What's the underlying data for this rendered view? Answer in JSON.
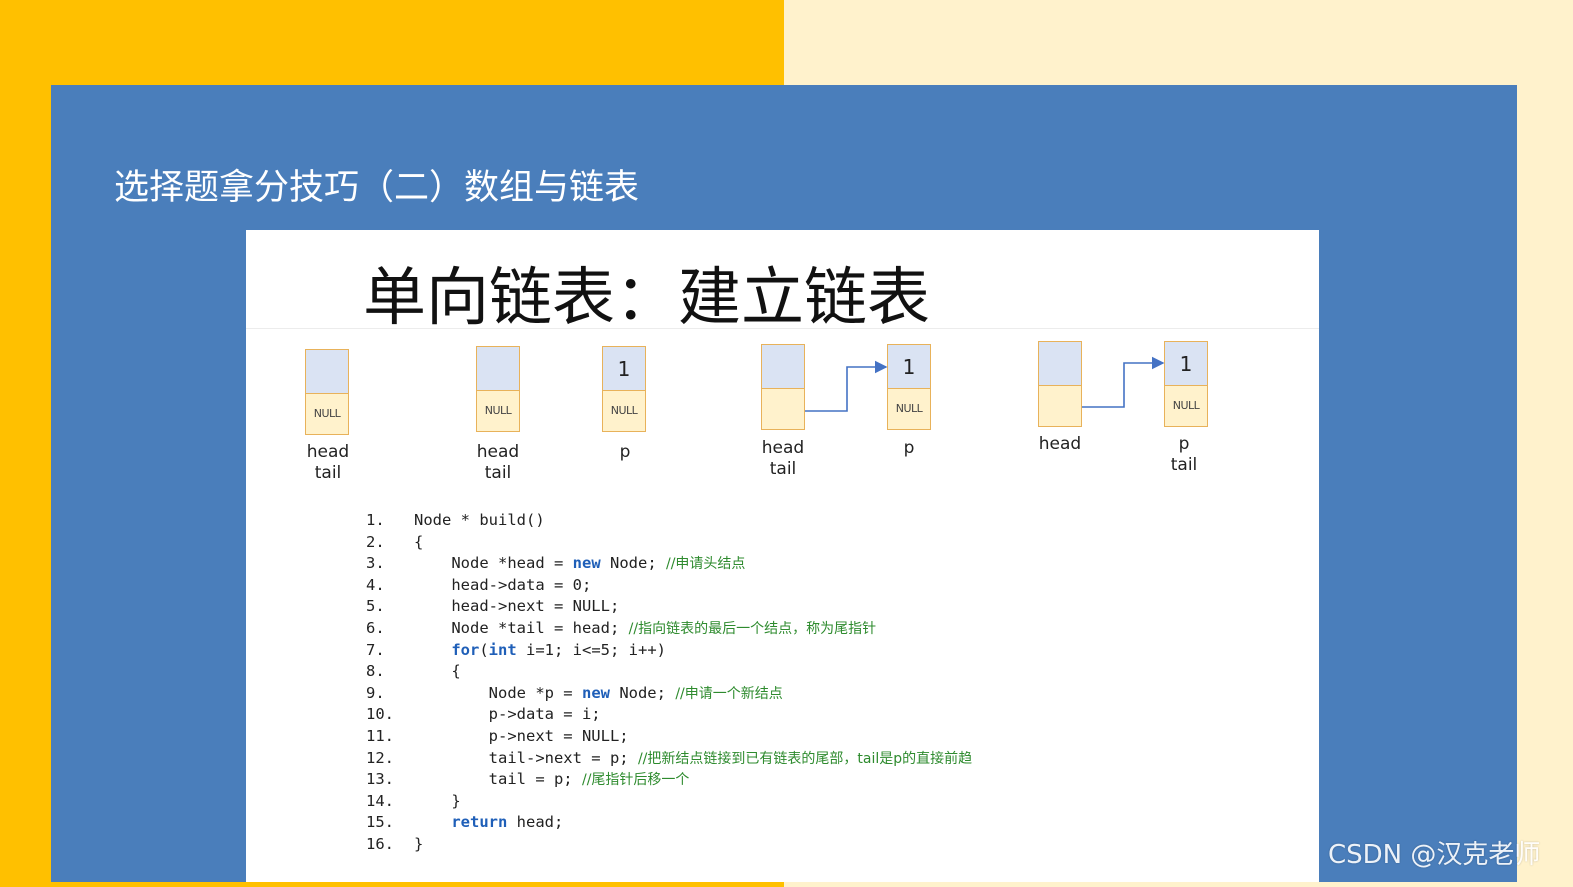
{
  "slide": {
    "title": "选择题拿分技巧（二）数组与链表"
  },
  "card": {
    "heading": "单向链表：建立链表"
  },
  "diagram": {
    "nodes": [
      {
        "top": "",
        "bottom": "NULL"
      },
      {
        "top": "",
        "bottom": "NULL"
      },
      {
        "top": "1",
        "bottom": "NULL"
      },
      {
        "top": "",
        "bottom": ""
      },
      {
        "top": "1",
        "bottom": "NULL"
      },
      {
        "top": "",
        "bottom": ""
      },
      {
        "top": "1",
        "bottom": "NULL"
      }
    ],
    "labels": [
      {
        "l1": "head",
        "l2": "tail"
      },
      {
        "l1": "head",
        "l2": "tail"
      },
      {
        "l1": "p",
        "l2": ""
      },
      {
        "l1": "head",
        "l2": "tail"
      },
      {
        "l1": "p",
        "l2": ""
      },
      {
        "l1": "head",
        "l2": ""
      },
      {
        "l1": "p",
        "l2": "tail"
      }
    ]
  },
  "code": {
    "line_numbers": [
      "1.",
      "2.",
      "3.",
      "4.",
      "5.",
      "6.",
      "7.",
      "8.",
      "9.",
      "10.",
      "11.",
      "12.",
      "13.",
      "14.",
      "15.",
      "16."
    ],
    "l1": "Node * build()",
    "l2": "{",
    "l3a": "Node *head = ",
    "l3kw": "new",
    "l3b": " Node; ",
    "l3c": "//申请头结点",
    "l4": "head->data = 0;",
    "l5": "head->next = NULL;",
    "l6a": "Node *tail = head; ",
    "l6c": "//指向链表的最后一个结点，称为尾指针",
    "l7kw1": "for",
    "l7a": "(",
    "l7kw2": "int",
    "l7b": " i=1; i<=5; i++)",
    "l8": "{",
    "l9a": "Node *p = ",
    "l9kw": "new",
    "l9b": " Node; ",
    "l9c": "//申请一个新结点",
    "l10": "p->data = i;",
    "l11": "p->next = NULL;",
    "l12a": "tail->next = p; ",
    "l12c": "//把新结点链接到已有链表的尾部，tail是p的直接前趋",
    "l13a": "tail = p; ",
    "l13c": "//尾指针后移一个",
    "l14": "}",
    "l15kw": "return",
    "l15b": " head;",
    "l16": "}"
  },
  "watermark": "CSDN @汉克老师",
  "colors": {
    "yellow": "#ffc000",
    "cream": "#fff2cc",
    "blue": "#4a7ebb",
    "node_top": "#dae3f3",
    "node_bottom": "#fff2cc",
    "keyword": "#1f5fb8",
    "comment": "#2e8b2e"
  }
}
